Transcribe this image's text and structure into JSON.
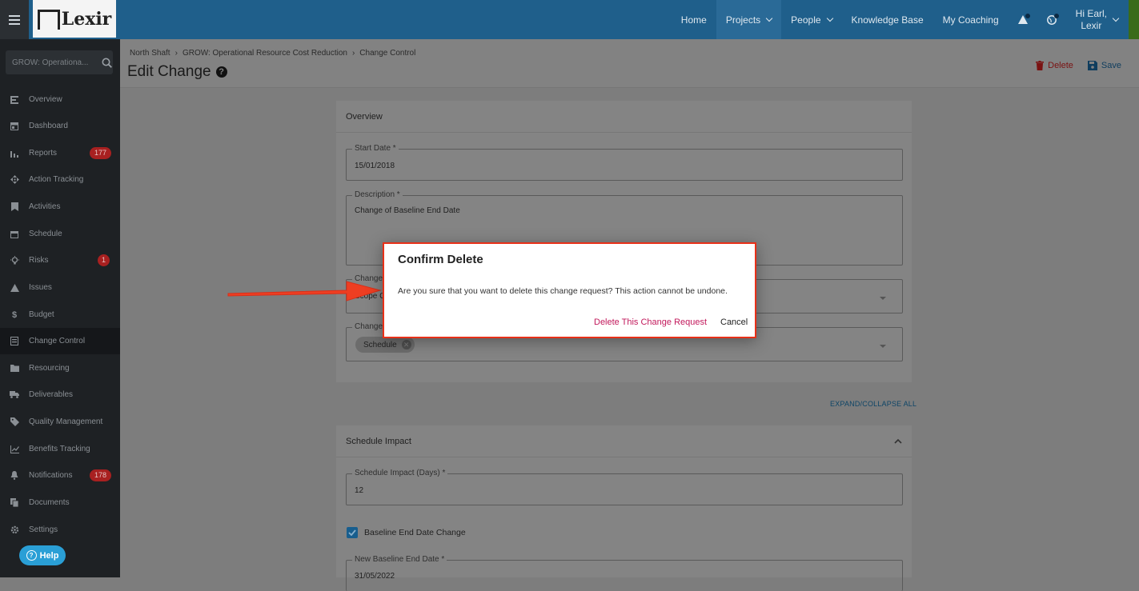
{
  "topbar": {
    "logo_text": "Lexir",
    "nav": [
      {
        "label": "Home"
      },
      {
        "label": "Projects"
      },
      {
        "label": "People"
      },
      {
        "label": "Knowledge Base"
      },
      {
        "label": "My Coaching"
      }
    ],
    "user_line1": "Hi Earl,",
    "user_line2": "Lexir",
    "accent_color": "#1f5f8b"
  },
  "sidebar": {
    "search_placeholder": "GROW: Operationa...",
    "items": [
      {
        "label": "Overview",
        "icon": "list-icon"
      },
      {
        "label": "Dashboard",
        "icon": "dashboard-icon"
      },
      {
        "label": "Reports",
        "icon": "bar-chart-icon",
        "badge": "177"
      },
      {
        "label": "Action Tracking",
        "icon": "move-icon"
      },
      {
        "label": "Activities",
        "icon": "bookmark-icon"
      },
      {
        "label": "Schedule",
        "icon": "calendar-icon"
      },
      {
        "label": "Risks",
        "icon": "lightbulb-icon",
        "badge": "1"
      },
      {
        "label": "Issues",
        "icon": "warning-icon"
      },
      {
        "label": "Budget",
        "icon": "dollar-icon"
      },
      {
        "label": "Change Control",
        "icon": "change-icon"
      },
      {
        "label": "Resourcing",
        "icon": "folder-icon"
      },
      {
        "label": "Deliverables",
        "icon": "truck-icon"
      },
      {
        "label": "Quality Management",
        "icon": "tag-icon"
      },
      {
        "label": "Benefits Tracking",
        "icon": "line-chart-icon"
      },
      {
        "label": "Notifications",
        "icon": "bell-icon",
        "badge": "178"
      },
      {
        "label": "Documents",
        "icon": "documents-icon"
      },
      {
        "label": "Settings",
        "icon": "gear-icon"
      }
    ],
    "help_label": "Help"
  },
  "header": {
    "breadcrumbs": [
      "North Shaft",
      "GROW: Operational Resource Cost Reduction",
      "Change Control"
    ],
    "title": "Edit Change",
    "delete_label": "Delete",
    "save_label": "Save"
  },
  "overview": {
    "title": "Overview",
    "start_date_label": "Start Date *",
    "start_date_value": "15/01/2018",
    "description_label": "Description *",
    "description_value": "Change of Baseline End Date",
    "change_type_label": "Change",
    "change_type_value": "Scope C",
    "change_area_label": "Change",
    "change_area_chip": "Schedule"
  },
  "expand_label": "EXPAND/COLLAPSE ALL",
  "schedule_impact": {
    "title": "Schedule Impact",
    "days_label": "Schedule Impact (Days) *",
    "days_value": "12",
    "checkbox_label": "Baseline End Date Change",
    "new_end_label": "New Baseline End Date *",
    "new_end_value": "31/05/2022"
  },
  "dialog": {
    "title": "Confirm Delete",
    "message": "Are you sure that you want to delete this change request? This action cannot be undone.",
    "confirm_label": "Delete This Change Request",
    "cancel_label": "Cancel",
    "highlight_color": "#e83018"
  }
}
